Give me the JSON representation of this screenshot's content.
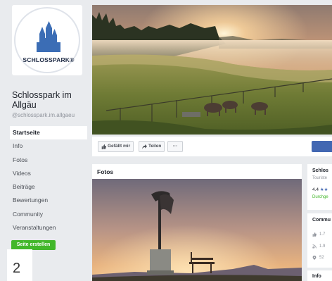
{
  "sidebar": {
    "logo_text": "SCHLOSSPARK®",
    "page_title": "Schlosspark im Allgäu",
    "page_handle": "@schlosspark.im.allgaeu",
    "nav_items": [
      {
        "label": "Startseite",
        "active": true
      },
      {
        "label": "Info"
      },
      {
        "label": "Fotos"
      },
      {
        "label": "Videos"
      },
      {
        "label": "Beiträge"
      },
      {
        "label": "Bewertungen"
      },
      {
        "label": "Community"
      },
      {
        "label": "Veranstaltungen"
      }
    ],
    "create_page_label": "Seite erstellen"
  },
  "page_number": "2",
  "actions": {
    "like_label": "Gefällt mir",
    "share_label": "Teilen",
    "more_label": "···"
  },
  "fotos": {
    "title": "Fotos"
  },
  "right": {
    "card1_title": "Schlos",
    "card1_category": "Touriste",
    "card1_rating": "4.4",
    "card1_link": "Durchge",
    "card2_title": "Commu",
    "card2_likes": "1.7",
    "card2_follows": "1.9",
    "card2_checkins": "52",
    "card3_title": "Info"
  },
  "colors": {
    "fb_blue": "#4267b2",
    "create_green": "#42b72a",
    "logo_blue": "#3b6db5"
  }
}
